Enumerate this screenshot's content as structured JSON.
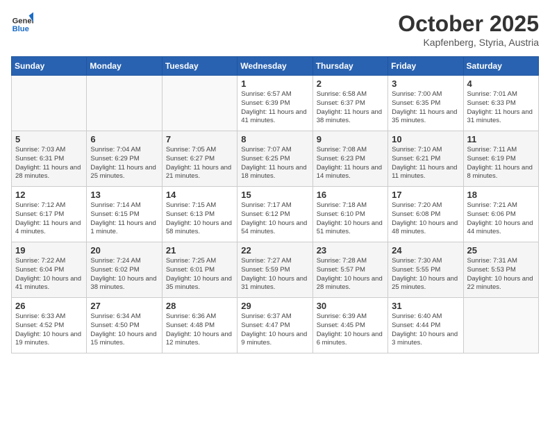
{
  "header": {
    "logo_line1": "General",
    "logo_line2": "Blue",
    "month": "October 2025",
    "location": "Kapfenberg, Styria, Austria"
  },
  "days_of_week": [
    "Sunday",
    "Monday",
    "Tuesday",
    "Wednesday",
    "Thursday",
    "Friday",
    "Saturday"
  ],
  "weeks": [
    [
      {
        "day": "",
        "empty": true
      },
      {
        "day": "",
        "empty": true
      },
      {
        "day": "",
        "empty": true
      },
      {
        "day": "1",
        "sunrise": "6:57 AM",
        "sunset": "6:39 PM",
        "daylight": "11 hours and 41 minutes."
      },
      {
        "day": "2",
        "sunrise": "6:58 AM",
        "sunset": "6:37 PM",
        "daylight": "11 hours and 38 minutes."
      },
      {
        "day": "3",
        "sunrise": "7:00 AM",
        "sunset": "6:35 PM",
        "daylight": "11 hours and 35 minutes."
      },
      {
        "day": "4",
        "sunrise": "7:01 AM",
        "sunset": "6:33 PM",
        "daylight": "11 hours and 31 minutes."
      }
    ],
    [
      {
        "day": "5",
        "sunrise": "7:03 AM",
        "sunset": "6:31 PM",
        "daylight": "11 hours and 28 minutes."
      },
      {
        "day": "6",
        "sunrise": "7:04 AM",
        "sunset": "6:29 PM",
        "daylight": "11 hours and 25 minutes."
      },
      {
        "day": "7",
        "sunrise": "7:05 AM",
        "sunset": "6:27 PM",
        "daylight": "11 hours and 21 minutes."
      },
      {
        "day": "8",
        "sunrise": "7:07 AM",
        "sunset": "6:25 PM",
        "daylight": "11 hours and 18 minutes."
      },
      {
        "day": "9",
        "sunrise": "7:08 AM",
        "sunset": "6:23 PM",
        "daylight": "11 hours and 14 minutes."
      },
      {
        "day": "10",
        "sunrise": "7:10 AM",
        "sunset": "6:21 PM",
        "daylight": "11 hours and 11 minutes."
      },
      {
        "day": "11",
        "sunrise": "7:11 AM",
        "sunset": "6:19 PM",
        "daylight": "11 hours and 8 minutes."
      }
    ],
    [
      {
        "day": "12",
        "sunrise": "7:12 AM",
        "sunset": "6:17 PM",
        "daylight": "11 hours and 4 minutes."
      },
      {
        "day": "13",
        "sunrise": "7:14 AM",
        "sunset": "6:15 PM",
        "daylight": "11 hours and 1 minute."
      },
      {
        "day": "14",
        "sunrise": "7:15 AM",
        "sunset": "6:13 PM",
        "daylight": "10 hours and 58 minutes."
      },
      {
        "day": "15",
        "sunrise": "7:17 AM",
        "sunset": "6:12 PM",
        "daylight": "10 hours and 54 minutes."
      },
      {
        "day": "16",
        "sunrise": "7:18 AM",
        "sunset": "6:10 PM",
        "daylight": "10 hours and 51 minutes."
      },
      {
        "day": "17",
        "sunrise": "7:20 AM",
        "sunset": "6:08 PM",
        "daylight": "10 hours and 48 minutes."
      },
      {
        "day": "18",
        "sunrise": "7:21 AM",
        "sunset": "6:06 PM",
        "daylight": "10 hours and 44 minutes."
      }
    ],
    [
      {
        "day": "19",
        "sunrise": "7:22 AM",
        "sunset": "6:04 PM",
        "daylight": "10 hours and 41 minutes."
      },
      {
        "day": "20",
        "sunrise": "7:24 AM",
        "sunset": "6:02 PM",
        "daylight": "10 hours and 38 minutes."
      },
      {
        "day": "21",
        "sunrise": "7:25 AM",
        "sunset": "6:01 PM",
        "daylight": "10 hours and 35 minutes."
      },
      {
        "day": "22",
        "sunrise": "7:27 AM",
        "sunset": "5:59 PM",
        "daylight": "10 hours and 31 minutes."
      },
      {
        "day": "23",
        "sunrise": "7:28 AM",
        "sunset": "5:57 PM",
        "daylight": "10 hours and 28 minutes."
      },
      {
        "day": "24",
        "sunrise": "7:30 AM",
        "sunset": "5:55 PM",
        "daylight": "10 hours and 25 minutes."
      },
      {
        "day": "25",
        "sunrise": "7:31 AM",
        "sunset": "5:53 PM",
        "daylight": "10 hours and 22 minutes."
      }
    ],
    [
      {
        "day": "26",
        "sunrise": "6:33 AM",
        "sunset": "4:52 PM",
        "daylight": "10 hours and 19 minutes."
      },
      {
        "day": "27",
        "sunrise": "6:34 AM",
        "sunset": "4:50 PM",
        "daylight": "10 hours and 15 minutes."
      },
      {
        "day": "28",
        "sunrise": "6:36 AM",
        "sunset": "4:48 PM",
        "daylight": "10 hours and 12 minutes."
      },
      {
        "day": "29",
        "sunrise": "6:37 AM",
        "sunset": "4:47 PM",
        "daylight": "10 hours and 9 minutes."
      },
      {
        "day": "30",
        "sunrise": "6:39 AM",
        "sunset": "4:45 PM",
        "daylight": "10 hours and 6 minutes."
      },
      {
        "day": "31",
        "sunrise": "6:40 AM",
        "sunset": "4:44 PM",
        "daylight": "10 hours and 3 minutes."
      },
      {
        "day": "",
        "empty": true
      }
    ]
  ]
}
